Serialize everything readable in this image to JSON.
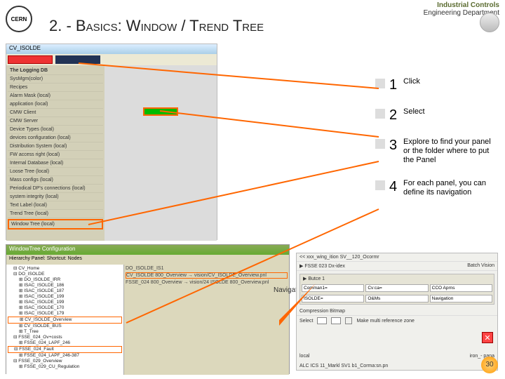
{
  "header": {
    "title": "2. - Basics: Window / Trend Tree",
    "brand_small": "Industrial Controls",
    "brand_sub": "Engineering Department",
    "logo_text": "CERN"
  },
  "steps": [
    {
      "num": "1",
      "txt": "Click"
    },
    {
      "num": "2",
      "txt": "Select"
    },
    {
      "num": "3",
      "txt": "Explore to find your panel or the folder where to put the Panel"
    },
    {
      "num": "4",
      "txt": "For each panel, you can define its navigation"
    }
  ],
  "s1": {
    "titlebar": "CV_ISOLDE",
    "menu_header": "The Logging DB",
    "items": [
      "SysMgm(color)",
      "Recipes",
      "Alarm Mask (local)",
      "application (local)",
      "CMW Client",
      "CMW Server",
      "Device Types (local)",
      "devices configuration (local)",
      "Distribution System (local)",
      "FW access right (local)",
      "Internal Database (local)",
      "Loose Tree (local)",
      "Mass configs (local)",
      "Periodical DP's connections (local)",
      "system integrity (local)",
      "Text Label (local)",
      "Trend Tree (local)",
      "Window Tree (local)"
    ]
  },
  "s2": {
    "titlebar": "WindowTree Configuration",
    "toolbar": "Hierarchy     Panel:     Shortcut:    Nodes",
    "tree": [
      {
        "t": "CV_Home",
        "l": 1
      },
      {
        "t": "DO_ISOLDE",
        "l": 1
      },
      {
        "t": "DO_ISOLDE_IRR",
        "l": 2
      },
      {
        "t": "ISAC_ISOLDE_186",
        "l": 2
      },
      {
        "t": "ISAC_ISOLDE_187",
        "l": 2
      },
      {
        "t": "ISAC_ISOLDE_199",
        "l": 2
      },
      {
        "t": "ISAC_ISOLDE_199",
        "l": 2
      },
      {
        "t": "ISAC_ISOLDE_170",
        "l": 2
      },
      {
        "t": "ISAC_ISOLDE_179",
        "l": 2
      },
      {
        "t": "CV_ISOLDE_Overview",
        "l": 2,
        "hl": true
      },
      {
        "t": "CV_ISOLDE_BUS",
        "l": 2
      },
      {
        "t": "T_Tree",
        "l": 2
      },
      {
        "t": "FSSE_024_Ov+costs",
        "l": 1
      },
      {
        "t": "FSSE_024_LAPF_246",
        "l": 2
      },
      {
        "t": "FSSE_024_Fault",
        "l": 1,
        "hl": true
      },
      {
        "t": "FSSE_024_LAPF_246-387",
        "l": 2
      },
      {
        "t": "FSSE_029_Overview",
        "l": 1
      },
      {
        "t": "FSSE_029_CU_Regulation",
        "l": 2
      }
    ],
    "right_line1": "DO_ISOLDE_IS1",
    "right_line2": "CV_ISOLDE 800_Overview → vision/CV_ISOLDE_Overview.pnl",
    "right_line3": "FSSE_024 800_Overview → vision/24 ISOLDE 800_Overview.pnl"
  },
  "nav_callout": "Navigation Buttons",
  "s3": {
    "row1": "<<  xxx_wing_ition   SV__120_Ocormr",
    "row2": "▶  FSSE 023  Dx-idex",
    "row3": "Batch  Vision",
    "panel_label": "▶  Butce 1",
    "cells1": [
      "Comman1=",
      "Cv:ca=",
      "CCO Aprns"
    ],
    "cells2": [
      "ISOLDE=",
      "O&Ms",
      "Navigation"
    ],
    "comp": "Compression Bitmap",
    "select": "Select",
    "chk": "Make multi reference zone",
    "bottom": "local",
    "bottom2": "iron_- pana",
    "bottom3": "ALC ICS 11_Markl  SV1 b1_Corma:sn.pn"
  },
  "page_number": "30"
}
